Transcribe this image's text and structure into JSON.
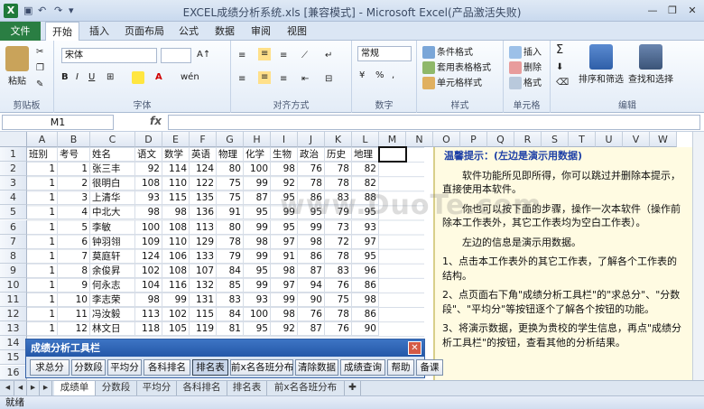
{
  "window": {
    "title": "EXCEL成绩分析系统.xls  [兼容模式]  -  Microsoft Excel(产品激活失败)",
    "app_logo": "X"
  },
  "ribbon_tabs": [
    "文件",
    "开始",
    "插入",
    "页面布局",
    "公式",
    "数据",
    "审阅",
    "视图"
  ],
  "active_tab": "开始",
  "ribbon": {
    "clipboard": {
      "paste": "粘贴",
      "label": "剪贴板"
    },
    "font": {
      "name": "宋体",
      "label": "字体"
    },
    "alignment": {
      "label": "对齐方式"
    },
    "number": {
      "format": "常规",
      "percent": "%",
      "label": "数字"
    },
    "styles": {
      "cond": "条件格式",
      "table": "套用表格格式",
      "cell": "单元格样式",
      "label": "样式"
    },
    "cells": {
      "insert": "插入",
      "delete": "删除",
      "format": "格式",
      "label": "单元格"
    },
    "editing": {
      "sigma": "Σ",
      "sort": "排序和筛选",
      "find": "查找和选择",
      "label": "编辑"
    }
  },
  "name_box": "M1",
  "fx": "fx",
  "columns": [
    "A",
    "B",
    "C",
    "D",
    "E",
    "F",
    "G",
    "H",
    "I",
    "J",
    "K",
    "L",
    "M",
    "N",
    "O",
    "P",
    "Q",
    "R",
    "S",
    "T",
    "U",
    "V",
    "W"
  ],
  "header_row": [
    "班别",
    "考号",
    "姓名",
    "语文",
    "数学",
    "英语",
    "物理",
    "化学",
    "生物",
    "政治",
    "历史",
    "地理"
  ],
  "rows": [
    [
      1,
      1,
      "张三丰",
      92,
      114,
      124,
      80,
      100,
      98,
      76,
      78,
      82
    ],
    [
      1,
      2,
      "很明白",
      108,
      110,
      122,
      75,
      99,
      92,
      78,
      78,
      82
    ],
    [
      1,
      3,
      "上清华",
      93,
      115,
      135,
      75,
      87,
      95,
      86,
      83,
      88
    ],
    [
      1,
      4,
      "中北大",
      98,
      98,
      136,
      91,
      95,
      99,
      95,
      79,
      95
    ],
    [
      1,
      5,
      "李敏",
      100,
      108,
      113,
      80,
      99,
      95,
      99,
      73,
      93
    ],
    [
      1,
      6,
      "钟羽翎",
      109,
      110,
      129,
      78,
      98,
      97,
      98,
      72,
      97
    ],
    [
      1,
      7,
      "莫庭轩",
      124,
      106,
      133,
      79,
      99,
      91,
      86,
      78,
      95
    ],
    [
      1,
      8,
      "余俊昇",
      102,
      108,
      107,
      84,
      95,
      98,
      87,
      83,
      96
    ],
    [
      1,
      9,
      "何永志",
      104,
      116,
      132,
      85,
      99,
      97,
      94,
      76,
      86
    ],
    [
      1,
      10,
      "李志荣",
      98,
      99,
      131,
      83,
      93,
      99,
      90,
      75,
      98
    ],
    [
      1,
      11,
      "冯汝毅",
      113,
      102,
      115,
      84,
      100,
      98,
      76,
      78,
      86
    ],
    [
      1,
      12,
      "林文日",
      118,
      105,
      119,
      81,
      95,
      92,
      87,
      76,
      90
    ]
  ],
  "row_numbers": [
    "1",
    "2",
    "3",
    "4",
    "5",
    "6",
    "7",
    "8",
    "9",
    "10",
    "11",
    "12",
    "13",
    "14",
    "15",
    "16"
  ],
  "panel": {
    "title": "温馨提示：(左边是演示用数据)",
    "p1": "软件功能所见即所得，你可以跳过并删除本提示，直接使用本软件。",
    "p2": "你也可以按下面的步骤，操作一次本软件（操作前除本工作表外，其它工作表均为空白工作表）。",
    "p3": "左边的信息是演示用数据。",
    "p4": "1、点击本工作表外的其它工作表，了解各个工作表的结构。",
    "p5": "2、点页面右下角\"成绩分析工具栏\"的\"求总分\"、\"分数段\"、\"平均分\"等按钮逐个了解各个按钮的功能。",
    "p6": "3、将演示数据，更换为贵校的学生信息，再点\"成绩分析工具栏\"的按钮，查看其他的分析结果。"
  },
  "toolbar": {
    "title": "成绩分析工具栏",
    "buttons": [
      "求总分",
      "分数段",
      "平均分",
      "各科排名",
      "排名表",
      "前x名各班分布",
      "清除数据",
      "成绩查询",
      "帮助",
      "备课"
    ],
    "pressed": "排名表"
  },
  "sheet_tabs": [
    "成绩单",
    "分数段",
    "平均分",
    "各科排名",
    "排名表",
    "前x名各班分布"
  ],
  "status": "就绪",
  "watermark": "www.DuoTe.com",
  "colors": {
    "file_tab": "#2a7e43",
    "panel_bg": "#fffbe2",
    "toolbar_title": "#2458a8",
    "panel_title": "#1d3fa6"
  }
}
